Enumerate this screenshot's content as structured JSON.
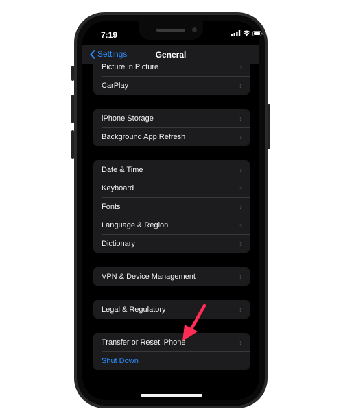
{
  "status": {
    "time": "7:19"
  },
  "nav": {
    "back_label": "Settings",
    "title": "General"
  },
  "groups": [
    {
      "items": [
        "Picture in Picture",
        "CarPlay"
      ]
    },
    {
      "items": [
        "iPhone Storage",
        "Background App Refresh"
      ]
    },
    {
      "items": [
        "Date & Time",
        "Keyboard",
        "Fonts",
        "Language & Region",
        "Dictionary"
      ]
    },
    {
      "items": [
        "VPN & Device Management"
      ]
    },
    {
      "items": [
        "Legal & Regulatory"
      ]
    },
    {
      "items": [
        "Transfer or Reset iPhone"
      ],
      "shutdown": "Shut Down"
    }
  ],
  "colors": {
    "accent": "#2b8cff",
    "annotation_arrow": "#ff2d55"
  },
  "icons": [
    "chevron-left-icon",
    "chevron-right-icon",
    "signal-icon",
    "wifi-icon",
    "battery-icon",
    "red-arrow-icon"
  ]
}
